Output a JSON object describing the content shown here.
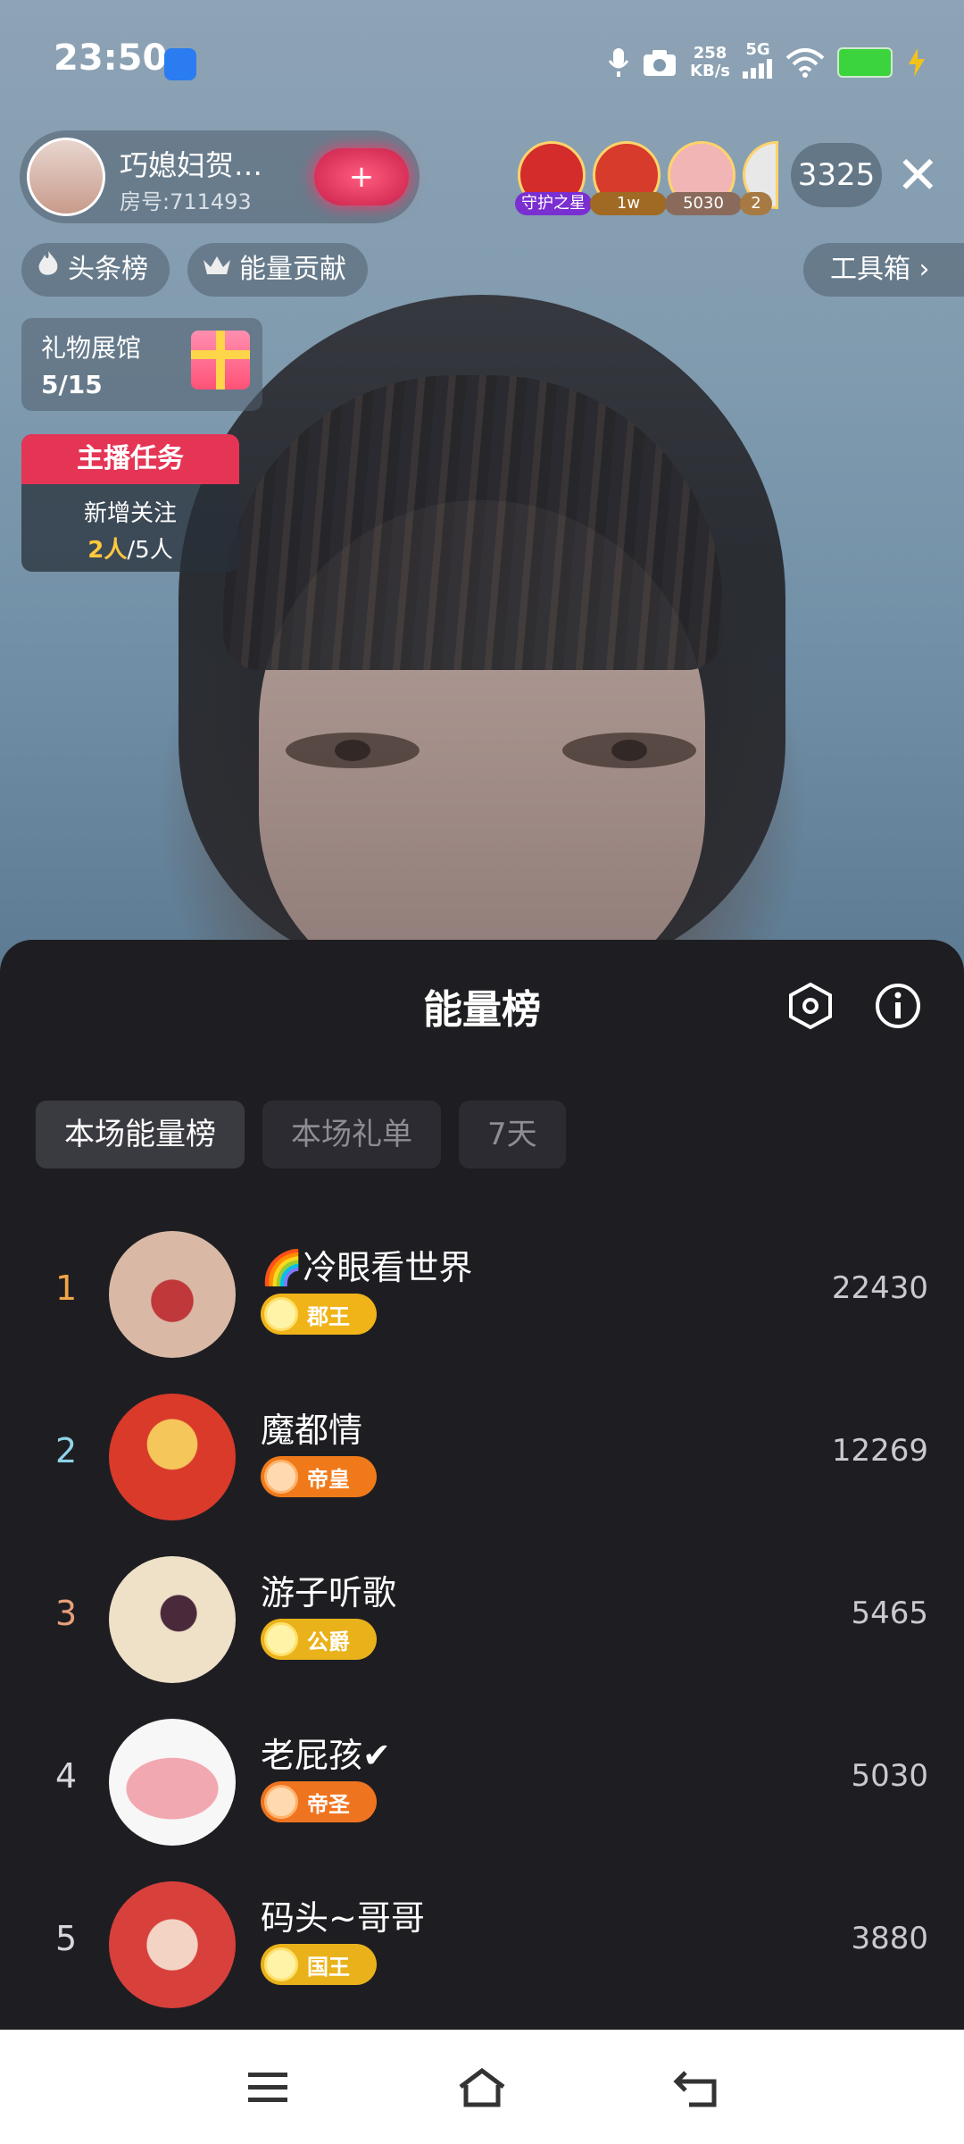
{
  "status_bar": {
    "time": "23:50",
    "speed_value": "258",
    "speed_unit": "KB/s",
    "network": "5G",
    "icons": [
      "cast-icon",
      "mic-icon",
      "camera-icon",
      "signal-icon",
      "wifi-icon",
      "battery-icon",
      "charging-icon"
    ]
  },
  "live_header": {
    "anchor_name": "巧媳妇贺…",
    "room_id": "房号:711493",
    "follow_label": "+",
    "guards": [
      {
        "tag": "守护之星",
        "tag_color": "#7a2fd0",
        "avatar_color": "#d42b2b"
      },
      {
        "tag": "1w",
        "tag_color": "#a06a24",
        "avatar_color": "#d63b2b"
      },
      {
        "tag": "5030",
        "tag_color": "#8a6a5a",
        "avatar_color": "#f1b5b5"
      },
      {
        "tag": "2",
        "tag_color": "#a77a44",
        "avatar_color": "#e8e8e8"
      }
    ],
    "viewer_count": "3325",
    "close_label": "✕"
  },
  "pills": {
    "headline_rank": "头条榜",
    "energy_contribution": "能量贡献",
    "toolbox": "工具箱 ›"
  },
  "gift_hall": {
    "title": "礼物展馆",
    "progress": "5/15"
  },
  "anchor_task": {
    "header": "主播任务",
    "line1": "新增关注",
    "current": "2人",
    "total": "/5人"
  },
  "sheet": {
    "title": "能量榜",
    "tabs": [
      "本场能量榜",
      "本场礼单",
      "7天"
    ],
    "active_tab": 0,
    "rows": [
      {
        "rank": "1",
        "rank_color": "#f0a64a",
        "name": "🌈冷眼看世界",
        "badge": "郡王",
        "badge_color": "#f0b419",
        "score": "22430",
        "avatar_color": "#d9b9a6"
      },
      {
        "rank": "2",
        "rank_color": "#8fd3e8",
        "name": "魔都情",
        "badge": "帝皇",
        "badge_color": "#f07a1a",
        "score": "12269",
        "avatar_color": "#d93a2a"
      },
      {
        "rank": "3",
        "rank_color": "#e8a07a",
        "name": "游子听歌",
        "badge": "公爵",
        "badge_color": "#e9b21a",
        "score": "5465",
        "avatar_color": "#efe0c8"
      },
      {
        "rank": "4",
        "rank_color": "#d6d6dc",
        "name": "老屁孩✔",
        "badge": "帝圣",
        "badge_color": "#ef7420",
        "score": "5030",
        "avatar_color": "#f2c4c8"
      },
      {
        "rank": "5",
        "rank_color": "#d6d6dc",
        "name": "码头~哥哥",
        "badge": "国王",
        "badge_color": "#e9b21a",
        "score": "3880",
        "avatar_color": "#d8403c"
      }
    ]
  },
  "nav_bar": {
    "icons": [
      "menu-icon",
      "home-icon",
      "back-icon"
    ]
  }
}
